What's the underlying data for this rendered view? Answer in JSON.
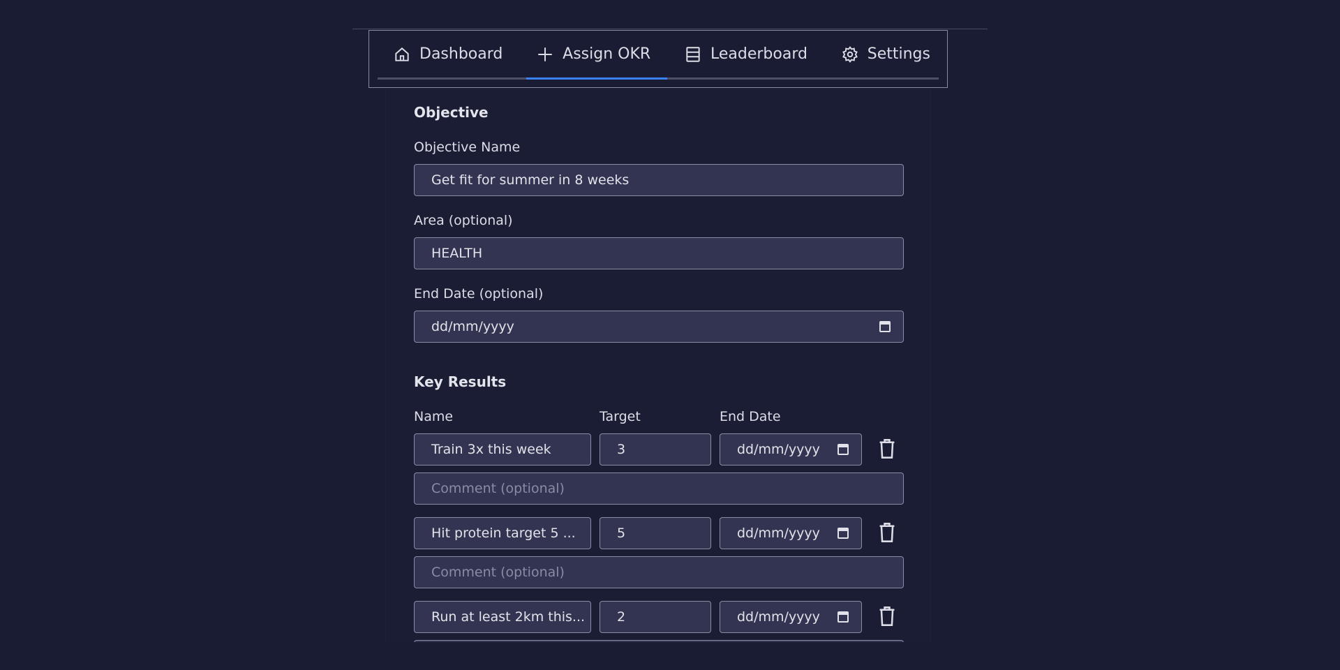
{
  "nav": {
    "tabs": [
      {
        "label": "Dashboard",
        "icon": "home-icon"
      },
      {
        "label": "Assign OKR",
        "icon": "plus-icon",
        "active": true
      },
      {
        "label": "Leaderboard",
        "icon": "list-icon"
      },
      {
        "label": "Settings",
        "icon": "gear-icon"
      }
    ],
    "accent": "#3b82f6"
  },
  "objective": {
    "section_title": "Objective",
    "name_label": "Objective Name",
    "name_value": "Get fit for summer in 8 weeks",
    "area_label": "Area (optional)",
    "area_value": "HEALTH",
    "end_date_label": "End Date (optional)",
    "end_date_value": "dd/mm/yyyy"
  },
  "key_results": {
    "section_title": "Key Results",
    "headers": {
      "name": "Name",
      "target": "Target",
      "end_date": "End Date"
    },
    "comment_placeholder": "Comment (optional)",
    "items": [
      {
        "name": "Train 3x this week",
        "target": "3",
        "end_date": "dd/mm/yyyy"
      },
      {
        "name": "Hit protein target 5 ...",
        "target": "5",
        "end_date": "dd/mm/yyyy"
      },
      {
        "name": "Run at least 2km this...",
        "target": "2",
        "end_date": "dd/mm/yyyy"
      }
    ]
  }
}
